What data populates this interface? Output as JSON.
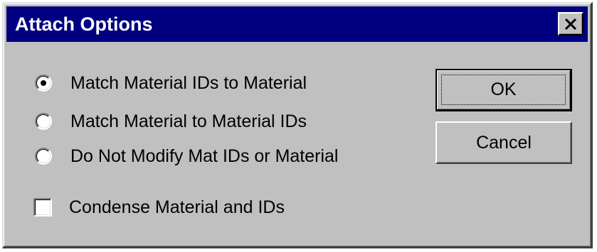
{
  "window": {
    "title": "Attach Options",
    "close_icon": "close-icon"
  },
  "options": {
    "radios": [
      {
        "label": "Match Material IDs to Material",
        "selected": true
      },
      {
        "label": "Match Material to Material IDs",
        "selected": false
      },
      {
        "label": "Do Not Modify Mat IDs or Material",
        "selected": false
      }
    ],
    "condense": {
      "label": "Condense Material and IDs",
      "checked": false
    }
  },
  "buttons": {
    "ok_label": "OK",
    "cancel_label": "Cancel"
  },
  "colors": {
    "titlebar": "#000080",
    "face": "#c0c0c0"
  }
}
